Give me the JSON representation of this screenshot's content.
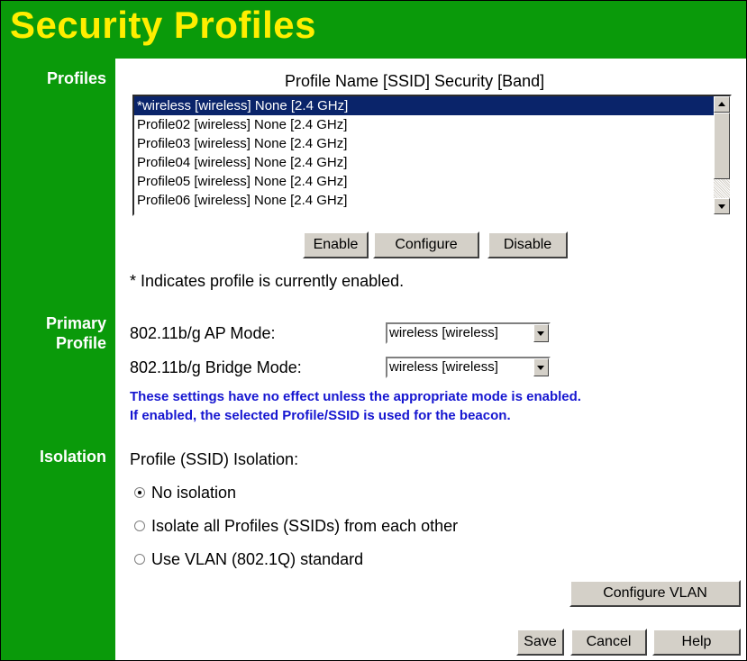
{
  "page_title": "Security Profiles",
  "sections": {
    "profiles": "Profiles",
    "primary_profile": "Primary Profile",
    "isolation": "Isolation"
  },
  "profiles": {
    "list_header": "Profile Name [SSID] Security [Band]",
    "items": [
      {
        "label": "*wireless [wireless] None [2.4 GHz]",
        "selected": true
      },
      {
        "label": "Profile02 [wireless] None [2.4 GHz]",
        "selected": false
      },
      {
        "label": "Profile03 [wireless] None [2.4 GHz]",
        "selected": false
      },
      {
        "label": "Profile04 [wireless] None [2.4 GHz]",
        "selected": false
      },
      {
        "label": "Profile05 [wireless] None [2.4 GHz]",
        "selected": false
      },
      {
        "label": "Profile06 [wireless] None [2.4 GHz]",
        "selected": false
      }
    ],
    "buttons": {
      "enable": "Enable",
      "configure": "Configure",
      "disable": "Disable"
    },
    "footnote": "* Indicates profile is currently enabled."
  },
  "primary_profile": {
    "ap_mode_label": "802.11b/g AP Mode:",
    "ap_mode_value": "wireless [wireless]",
    "bridge_mode_label": "802.11b/g Bridge Mode:",
    "bridge_mode_value": "wireless [wireless]",
    "note_line1": "These settings have no effect unless the appropriate mode is enabled.",
    "note_line2": "If enabled, the selected Profile/SSID is used for the beacon."
  },
  "isolation": {
    "label": "Profile (SSID) Isolation:",
    "options": [
      {
        "label": "No isolation",
        "checked": true
      },
      {
        "label": "Isolate all Profiles (SSIDs) from each other",
        "checked": false
      },
      {
        "label": "Use VLAN (802.1Q) standard",
        "checked": false
      }
    ],
    "configure_vlan": "Configure VLAN"
  },
  "footer": {
    "save": "Save",
    "cancel": "Cancel",
    "help": "Help"
  },
  "colors": {
    "sidebar": "#0a9a0a",
    "title": "#ffee00",
    "note": "#1515d0",
    "selection": "#0a246a"
  }
}
